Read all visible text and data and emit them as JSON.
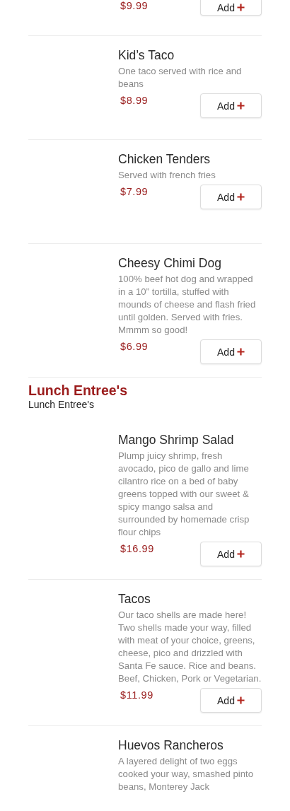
{
  "sections": [
    {
      "items": [
        {
          "price": "$9.99",
          "add_label": "Add"
        },
        {
          "name": "Kid’s Taco",
          "description": "One taco served with rice and beans",
          "price": "$8.99",
          "add_label": "Add"
        },
        {
          "name": "Chicken Tenders",
          "description": "Served with french fries",
          "price": "$7.99",
          "add_label": "Add"
        },
        {
          "name": "Cheesy Chimi Dog",
          "description": "100% beef hot dog and wrapped in a 10” tortilla, stuffed with mounds of cheese and flash fried until golden. Served with fries. Mmmm so good!",
          "price": "$6.99",
          "add_label": "Add"
        }
      ]
    },
    {
      "title": "Lunch Entree's",
      "subtitle": "Lunch Entree's",
      "items": [
        {
          "name": "Mango Shrimp Salad",
          "description": "Plump juicy shrimp, fresh avocado, pico de gallo and lime cilantro rice on a bed of baby greens topped with our sweet & spicy mango salsa and surrounded by homemade crisp flour chips",
          "price": "$16.99",
          "add_label": "Add"
        },
        {
          "name": "Tacos",
          "description": "Our taco shells are made here! Two shells made your way, filled with meat of your choice, greens, cheese, pico and drizzled with Santa Fe sauce. Rice and beans. Beef, Chicken, Pork or Vegetarian.",
          "price": "$11.99",
          "add_label": "Add"
        },
        {
          "name": "Huevos Rancheros",
          "description": "A layered delight of two eggs cooked your way, smashed pinto beans, Monterey Jack"
        }
      ]
    }
  ]
}
